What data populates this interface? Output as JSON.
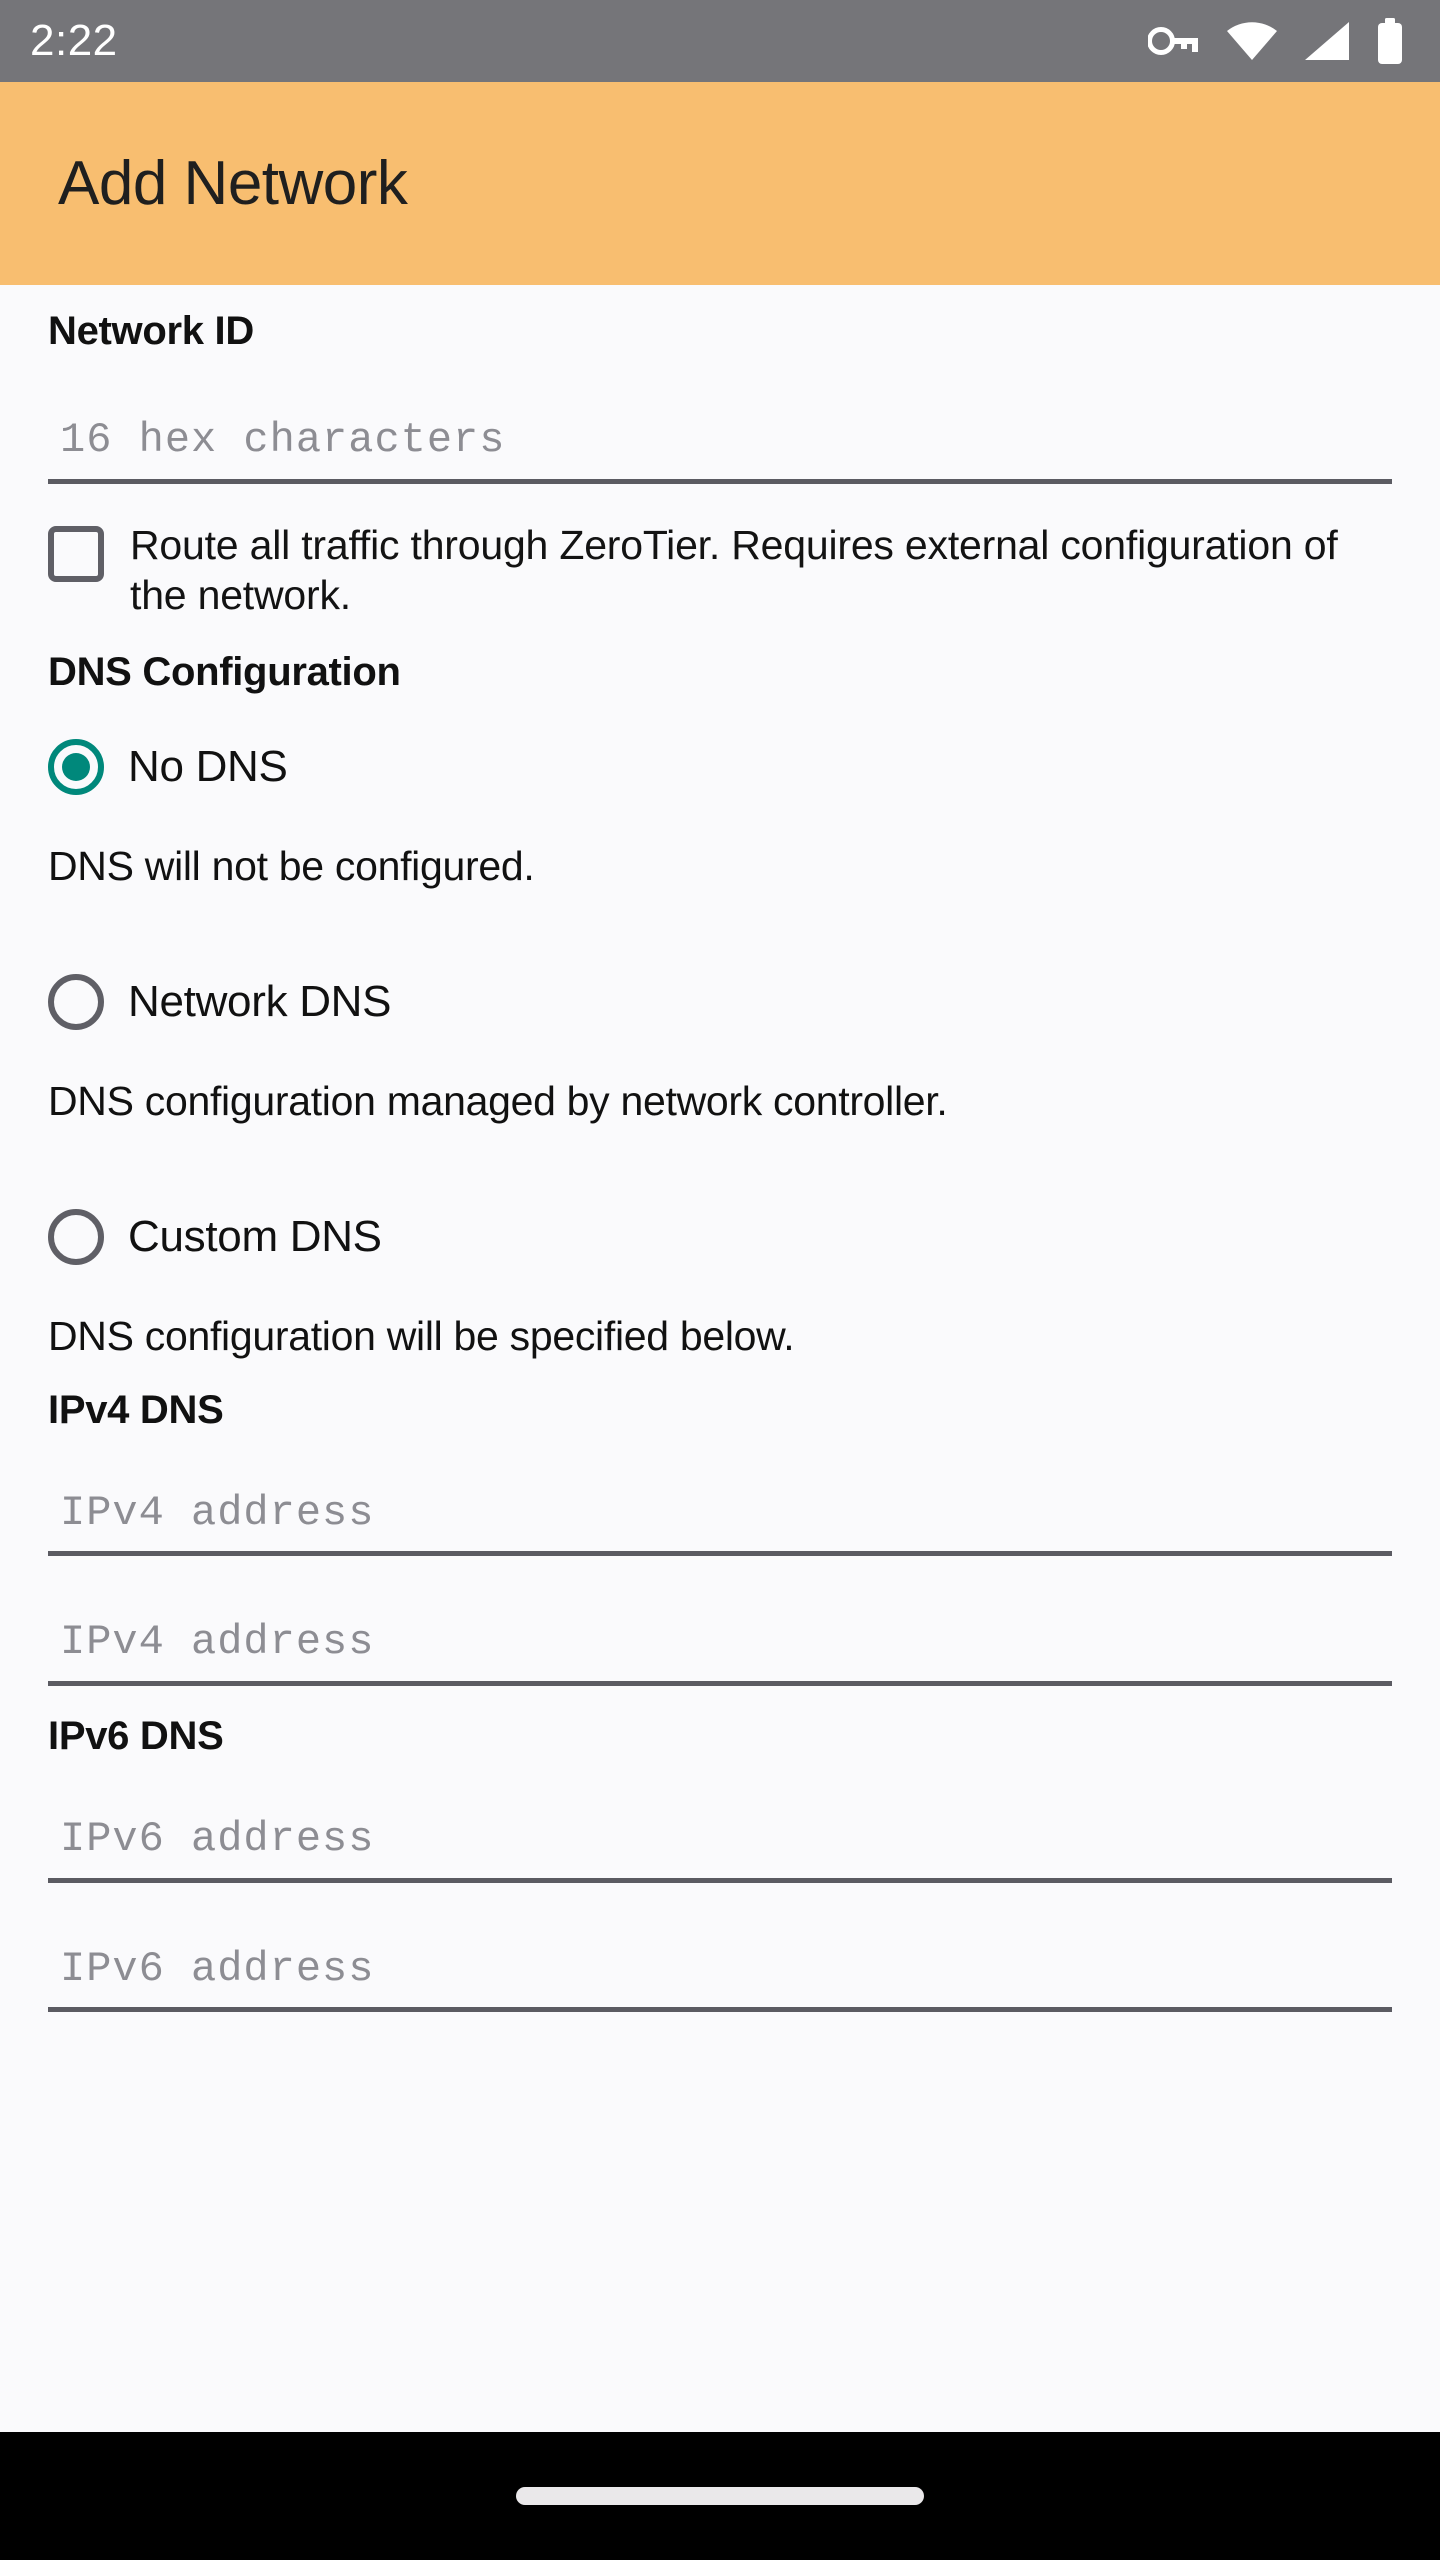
{
  "status_bar": {
    "time": "2:22",
    "icons": [
      "vpn-key-icon",
      "wifi-icon",
      "cellular-signal-icon",
      "battery-icon"
    ],
    "background_color": "#757579",
    "foreground_color": "#ffffff"
  },
  "app_bar": {
    "title": "Add Network",
    "background_color": "#F8BE70",
    "text_color": "#1f1f1f"
  },
  "theme": {
    "page_background": "#FAFAFC",
    "accent_color": "#00887B",
    "field_underline": "#5b5b62",
    "control_outline": "#5f5f66"
  },
  "form": {
    "network_id": {
      "label": "Network ID",
      "placeholder": "16 hex characters",
      "value": ""
    },
    "route_all_traffic": {
      "label": "Route all traffic through ZeroTier. Requires external configuration of the network.",
      "checked": false
    },
    "dns_configuration": {
      "label": "DNS Configuration",
      "selected": "No DNS",
      "options": [
        {
          "label": "No DNS",
          "description": "DNS will not be configured.",
          "selected": true
        },
        {
          "label": "Network DNS",
          "description": "DNS configuration managed by network controller.",
          "selected": false
        },
        {
          "label": "Custom DNS",
          "description": "DNS configuration will be specified below.",
          "selected": false
        }
      ]
    },
    "ipv4_dns": {
      "label": "IPv4 DNS",
      "fields": [
        {
          "placeholder": "IPv4 address",
          "value": ""
        },
        {
          "placeholder": "IPv4 address",
          "value": ""
        }
      ]
    },
    "ipv6_dns": {
      "label": "IPv6 DNS",
      "fields": [
        {
          "placeholder": "IPv6 address",
          "value": ""
        },
        {
          "placeholder": "IPv6 address",
          "value": ""
        }
      ]
    }
  },
  "nav_bar": {
    "gesture_pill": "home-gesture-pill",
    "background_color": "#000000"
  }
}
